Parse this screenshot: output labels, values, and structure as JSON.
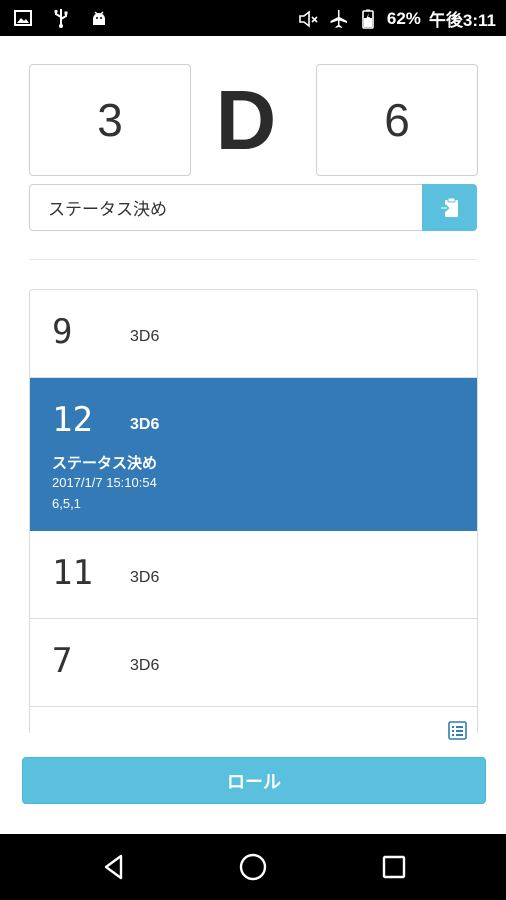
{
  "status_bar": {
    "battery_percent": "62%",
    "time": "午後3:11"
  },
  "dice": {
    "count": "3",
    "separator": "D",
    "sides": "6"
  },
  "label_input": {
    "value": "ステータス決め"
  },
  "history": [
    {
      "total": "9",
      "expr": "3D6"
    },
    {
      "total": "12",
      "expr": "3D6",
      "label": "ステータス決め",
      "timestamp": "2017/1/7 15:10:54",
      "rolls": "6,5,1",
      "selected": true
    },
    {
      "total": "11",
      "expr": "3D6"
    },
    {
      "total": "7",
      "expr": "3D6"
    }
  ],
  "roll_button": {
    "label": "ロール"
  },
  "colors": {
    "accent_info": "#5bc0de",
    "selected_row": "#337ab7"
  }
}
